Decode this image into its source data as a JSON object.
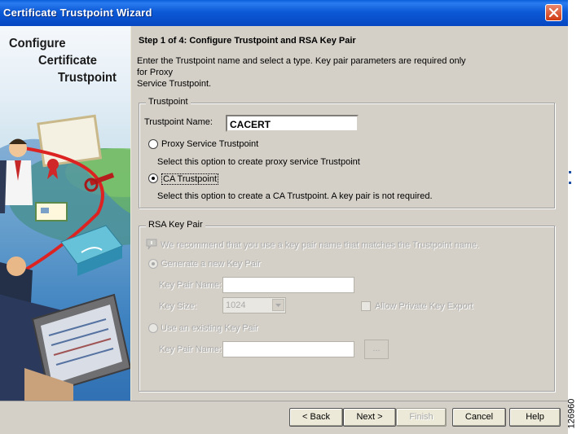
{
  "window": {
    "title": "Certificate Trustpoint Wizard"
  },
  "sidebar": {
    "line1": "Configure",
    "line2": "Certificate",
    "line3": "Trustpoint"
  },
  "step": {
    "title": "Step 1 of 4: Configure Trustpoint and RSA Key Pair",
    "desc_line1": "Enter the Trustpoint name and select a type. Key pair parameters are required only",
    "desc_line2": "for Proxy",
    "desc_line3": "Service Trustpoint."
  },
  "trustpoint": {
    "legend": "Trustpoint",
    "name_label": "Trustpoint Name:",
    "name_value": "CACERT",
    "proxy_label": "Proxy Service Trustpoint",
    "proxy_desc": "Select this option to create proxy service Trustpoint",
    "ca_label": "CA Trustpoint",
    "ca_desc": "Select this option to create a CA Trustpoint. A key pair is not required."
  },
  "rsa": {
    "legend": "RSA Key Pair",
    "hint": "We recommend that you use a key pair name that matches the Trustpoint name.",
    "generate_label": "Generate a new Key Pair",
    "keypair_name_label": "Key Pair Name:",
    "key_size_label": "Key Size:",
    "key_size_value": "1024",
    "allow_export_label": "Allow Private Key Export",
    "existing_label": "Use an existing Key Pair",
    "existing_name_label": "Key Pair Name:",
    "browse_label": "..."
  },
  "buttons": {
    "back": "< Back",
    "next": "Next >",
    "finish": "Finish",
    "cancel": "Cancel",
    "help": "Help"
  },
  "figure_id": "126960"
}
